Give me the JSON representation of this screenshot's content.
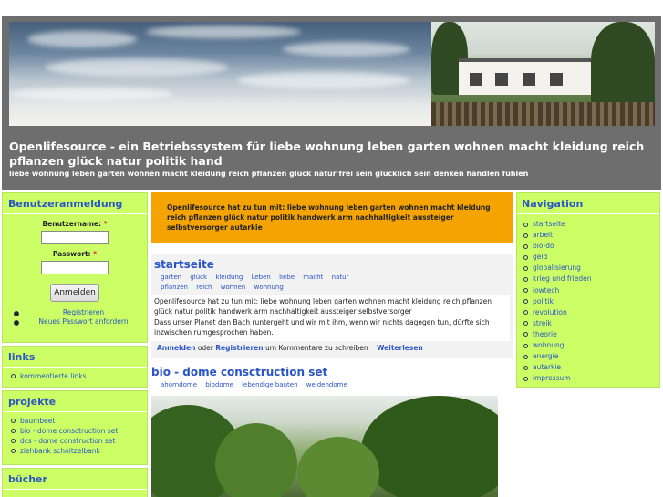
{
  "header": {
    "site_title": "Openlifesource - ein Betriebssystem für liebe wohnung leben garten wohnen macht kleidung reich pflanzen glück natur politik hand",
    "slogan": "liebe wohnung leben garten wohnen macht kleidung reich pflanzen glück natur frei sein glücklich sein denken handlen fühlen"
  },
  "login": {
    "title": "Benutzeranmeldung",
    "username_label": "Benutzername:",
    "password_label": "Passwort:",
    "required_mark": "*",
    "submit_label": "Anmelden",
    "register_link": "Registrieren",
    "new_password_link": "Neues Passwort anfordern"
  },
  "links_block": {
    "title": "links",
    "items": [
      "kommentierte links"
    ]
  },
  "projekte_block": {
    "title": "projekte",
    "items": [
      "baumbeet",
      "bio - dome consctruction set",
      "dcs - dome construction set",
      "ziehbank schnitzelbank"
    ]
  },
  "buecher_block": {
    "title": "bücher"
  },
  "notice": {
    "text": "Openlifesource hat zu tun mit: liebe wohnung leben garten wohnen macht kleidung reich pflanzen glück natur politik handwerk arm nachhaltigkeit aussteiger selbstversorger autarkie"
  },
  "node_start": {
    "title": "startseite",
    "tags": [
      "garten",
      "glück",
      "kleidung",
      "Leben",
      "liebe",
      "macht",
      "natur",
      "pflanzen",
      "reich",
      "wohnen",
      "wohnung"
    ],
    "body_1": "Openlifesource hat zu tun mit: liebe wohnung leben garten wohnen macht kleidung reich pflanzen glück natur politik handwerk arm nachhaltigkeit aussteiger selbstversorger",
    "body_2": "Dass unser Planet den Bach runtergeht und wir mit ihm, wenn wir nichts dagegen tun, dürfte sich inzwischen rumgesprochen haben.",
    "login_link": "Anmelden",
    "or_text": "oder",
    "register_link": "Registrieren",
    "comment_text": "um Kommentare zu schreiben",
    "read_more": "Weiterlesen"
  },
  "node_bio": {
    "title": "bio - dome consctruction set",
    "tags": [
      "ahorndome",
      "biodome",
      "lebendige bauten",
      "weidendome"
    ]
  },
  "navigation": {
    "title": "Navigation",
    "items": [
      "startseite",
      "arbeit",
      "bio-do",
      "geld",
      "globalisierung",
      "krieg und frieden",
      "lowtech",
      "politik",
      "revolution",
      "streik",
      "theorie",
      "wohnung",
      "energie",
      "autarkie",
      "impressum"
    ]
  },
  "colors": {
    "sidebar_bg": "#ccfe66",
    "notice_bg": "#f5a300",
    "link": "#2a54c8",
    "header_bg": "#6e6e6e"
  }
}
